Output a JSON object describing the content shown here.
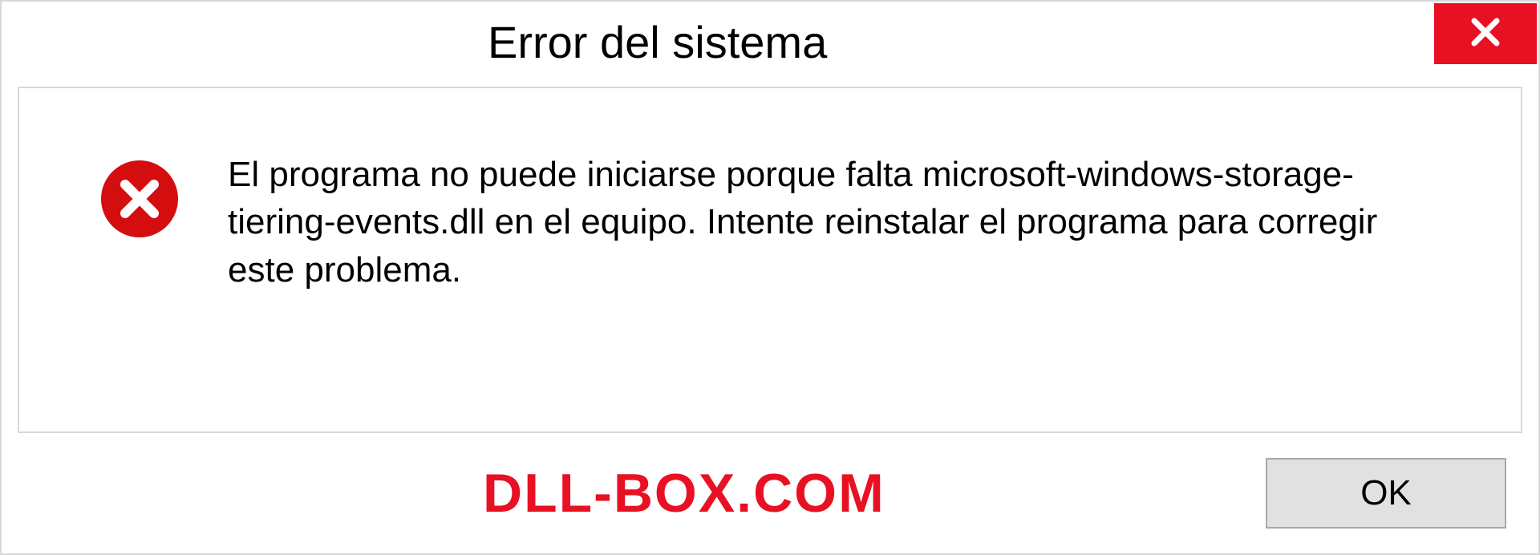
{
  "dialog": {
    "title": "Error del sistema",
    "message": "El programa no puede iniciarse porque falta microsoft-windows-storage-tiering-events.dll en el equipo. Intente reinstalar el programa para corregir este problema.",
    "ok_label": "OK"
  },
  "watermark": {
    "text": "DLL-BOX.COM"
  },
  "colors": {
    "close_button": "#e81123",
    "error_icon": "#d40e0e",
    "watermark": "#e81123"
  }
}
